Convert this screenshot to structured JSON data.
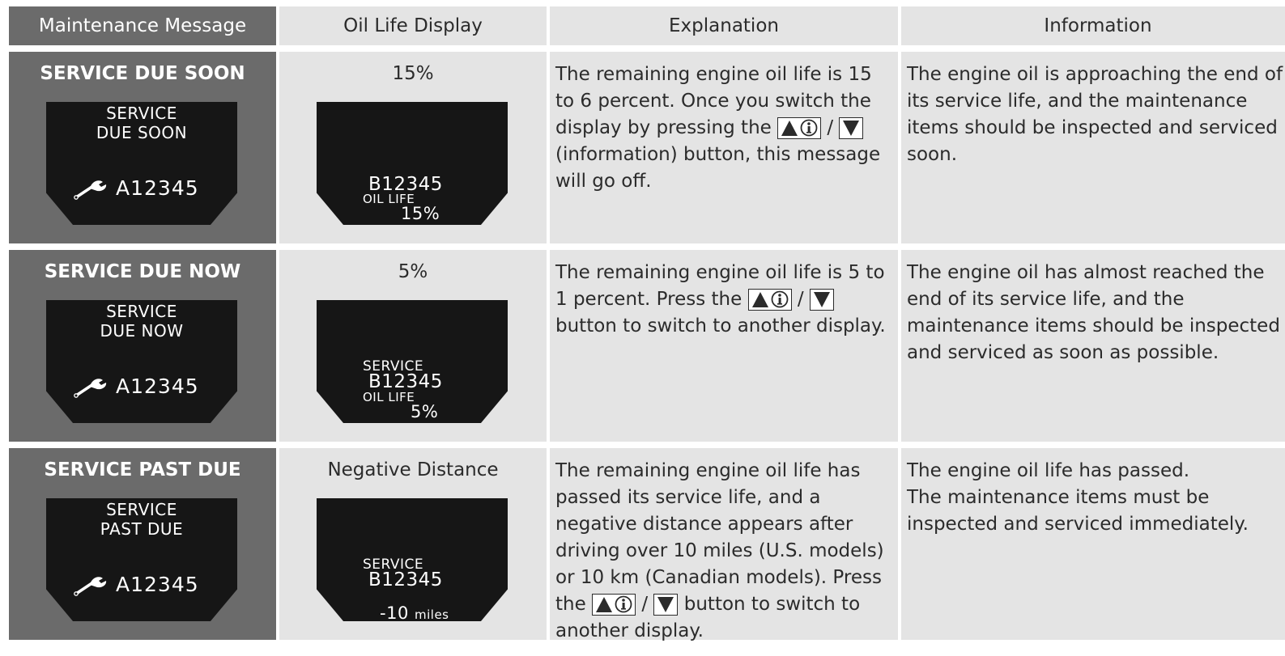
{
  "headers": {
    "maintenance_message": "Maintenance Message",
    "oil_life_display": "Oil Life Display",
    "explanation": "Explanation",
    "information": "Information"
  },
  "rows": [
    {
      "message": "SERVICE DUE SOON",
      "left_screen": {
        "line1": "SERVICE",
        "line2": "DUE SOON",
        "code": "A12345"
      },
      "oil_life": "15%",
      "right_screen": {
        "code": "B12345",
        "oil_life_label": "OIL LIFE",
        "value": "15%"
      },
      "explanation": {
        "part1": "The remaining engine oil life is 15 to 6 percent. Once you switch the display by pressing the",
        "slash": "/",
        "part2": "(information) button, this message will go off."
      },
      "information": "The engine oil is approaching the end of its service life, and the maintenance items should be inspected and serviced soon."
    },
    {
      "message": "SERVICE DUE NOW",
      "left_screen": {
        "line1": "SERVICE",
        "line2": "DUE NOW",
        "code": "A12345"
      },
      "oil_life": "5%",
      "right_screen": {
        "service": "SERVICE",
        "code": "B12345",
        "oil_life_label": "OIL LIFE",
        "value": "5%"
      },
      "explanation": {
        "part1": "The remaining engine oil life is 5 to 1 percent. Press the",
        "slash": "/",
        "part2": "button to switch to another display."
      },
      "information": "The engine oil has almost reached the end of its service life, and the maintenance items should be inspected and serviced as soon as possible."
    },
    {
      "message": "SERVICE PAST DUE",
      "left_screen": {
        "line1": "SERVICE",
        "line2": "PAST DUE",
        "code": "A12345"
      },
      "oil_life": "Negative Distance",
      "right_screen": {
        "service": "SERVICE",
        "code": "B12345",
        "distance": "-10",
        "unit": "miles"
      },
      "explanation": {
        "part1": "The remaining engine oil life has passed its service life, and a negative distance appears after driving over 10 miles (U.S. models) or 10 km (Canadian models). Press the",
        "slash": "/",
        "part2": "button to switch to another display."
      },
      "information_line1": "The engine oil life has passed.",
      "information_line2": "The maintenance items must be inspected and serviced immediately."
    }
  ],
  "icons": {
    "wrench": "wrench-icon",
    "up_info_button": "up-info-button-icon",
    "down_button": "down-button-icon"
  },
  "colors": {
    "header_bg": "#e4e4e4",
    "message_column_bg": "#6b6b6b",
    "screen_bg": "#161616",
    "text": "#2b2b2b"
  }
}
